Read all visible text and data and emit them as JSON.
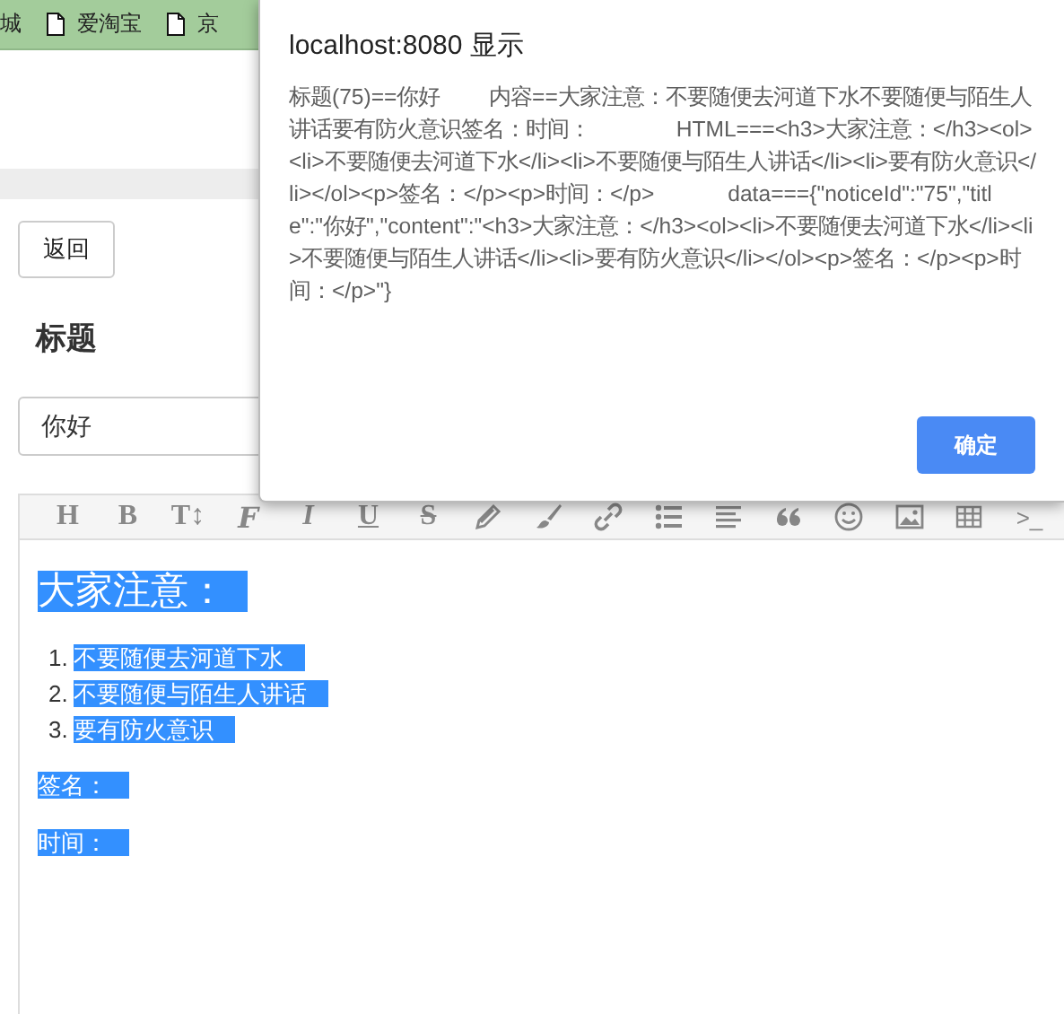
{
  "bookmarks": [
    {
      "label": "城",
      "icon": false
    },
    {
      "label": "爱淘宝",
      "icon": true
    },
    {
      "label": "京",
      "icon": true
    }
  ],
  "page": {
    "back_button": "返回",
    "title_label": "标题",
    "title_field": {
      "value": "你好"
    }
  },
  "editor": {
    "toolbar": {
      "text_buttons": [
        "H",
        "B",
        "T↕",
        "F",
        "I",
        "U",
        "S"
      ],
      "end_buttons": [
        ">_"
      ]
    },
    "content": {
      "selected": true,
      "heading": "大家注意：",
      "list": [
        {
          "marker": "1.",
          "text": "不要随便去河道下水"
        },
        {
          "marker": "2.",
          "text": "不要随便与陌生人讲话"
        },
        {
          "marker": "3.",
          "text": "要有防火意识"
        }
      ],
      "paragraphs": [
        "签名：",
        "时间："
      ]
    }
  },
  "dialog": {
    "title": "localhost:8080 显示",
    "message": "标题(75)==你好        内容==大家注意：不要随便去河道下水不要随便与陌生人讲话要有防火意识签名：时间：              HTML===<h3>大家注意：</h3><ol><li>不要随便去河道下水</li><li>不要随便与陌生人讲话</li><li>要有防火意识</li></ol><p>签名：</p><p>时间：</p>            data==={\"noticeId\":\"75\",\"title\":\"你好\",\"content\":\"<h3>大家注意：</h3><ol><li>不要随便去河道下水</li><li>不要随便与陌生人讲话</li><li>要有防火意识</li></ol><p>签名：</p><p>时间：</p>\"}",
    "ok_button": "确定"
  }
}
